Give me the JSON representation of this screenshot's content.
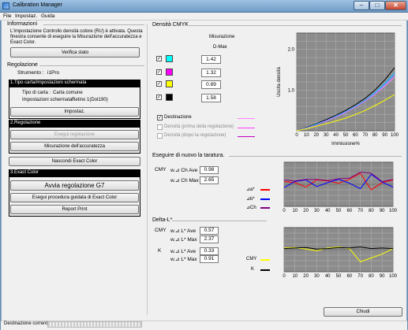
{
  "window": {
    "title": "Calibration Manager",
    "minimize_label": "–",
    "maximize_label": "□",
    "close_label": "✕"
  },
  "menu": {
    "file": "File",
    "settings": "Impostaz.",
    "help": "Guida"
  },
  "info": {
    "heading": "Informazioni",
    "text_line1": "L'impostazione Controllo densità colore (RU) è attivata. Questa",
    "text_line2": "finestra consente di eseguire la Misurazione dell'accuratezza e",
    "text_line3": "Exact Color.",
    "check_button": "Verifica stato"
  },
  "regulation": {
    "heading": "Regolazione",
    "instrument_label": "Strumento :",
    "instrument_value": "i1Pro",
    "section1_title": "1.Tipo carta/Impostazioni schermata",
    "paper_label": "Tipo di carta :",
    "paper_value": "Carta comune",
    "screen_label": "Impostazioni schermata :",
    "screen_value": "Retino 1(Dot190)",
    "settings_button": "Impostaz.",
    "section2_title": "2.Regolazione",
    "run_regulation_button": "Esegui regolazione",
    "accuracy_button": "Misurazione dell'accuratezza",
    "hide_exact_button": "Nascondi Exact Color",
    "section3_title": "3.Exact Color",
    "g7_button": "Avvia regolazione G7",
    "guided_button": "Esegui procedura guidata di Exact Color",
    "report_button": "Report Print"
  },
  "cmyk": {
    "heading": "Densità CMYK",
    "col_header1": "Misurazione",
    "col_header2": "D-Max",
    "rows": [
      {
        "name": "cyan",
        "color": "#00ffff",
        "value": "1.42",
        "check": "✓"
      },
      {
        "name": "magenta",
        "color": "#ff00ff",
        "value": "1.32",
        "check": "✓"
      },
      {
        "name": "yellow",
        "color": "#ffff00",
        "value": "0.89",
        "check": "✓"
      },
      {
        "name": "black",
        "color": "#000000",
        "value": "1.58",
        "check": "✓"
      }
    ],
    "legend": [
      {
        "label": "Destinazione",
        "check": "✓",
        "color": "#ff80ff"
      },
      {
        "label": "Densità (prima della regolazione)",
        "check": "",
        "color": "#ff40ff"
      },
      {
        "label": "Densità (dopo la regolazione)",
        "check": "",
        "color": "#c000c0"
      }
    ],
    "ylabel": "Uscita densità",
    "xlabel": "Immissione%"
  },
  "recal": {
    "heading": "Eseguire di nuovo la taratura.",
    "cmy_label": "CMY",
    "ave_label": "w.⊿ Ch Ave",
    "ave_value": "0.98",
    "max_label": "w.⊿ Ch Max",
    "max_value": "2.65",
    "legend": [
      {
        "label": "⊿a*",
        "color": "#ff0000"
      },
      {
        "label": "⊿b*",
        "color": "#0000ff"
      },
      {
        "label": "⊿Ch",
        "color": "#7f007f"
      }
    ]
  },
  "delta_l": {
    "heading": "Delta-L*",
    "cmy_label": "CMY",
    "k_label": "K",
    "cmy_ave_label": "w.⊿ L* Ave",
    "cmy_ave_value": "0.57",
    "cmy_max_label": "w.⊿ L* Max",
    "cmy_max_value": "2.37",
    "k_ave_label": "w.⊿ L* Ave",
    "k_ave_value": "0.33",
    "k_max_label": "w.⊿ L* Max",
    "k_max_value": "0.91",
    "legend": [
      {
        "label": "CMY",
        "color": "#ffff00"
      },
      {
        "label": "K",
        "color": "#000000"
      }
    ]
  },
  "footer": {
    "close_button": "Chiudi",
    "status_label": "Destinazione corrente"
  },
  "chart_data": [
    {
      "type": "line",
      "xlabel": "Immissione%",
      "ylabel": "Uscita densità",
      "x": [
        0,
        10,
        20,
        30,
        40,
        50,
        60,
        70,
        80,
        90,
        100
      ],
      "xlim": [
        0,
        100
      ],
      "ylim": [
        0,
        2.4
      ],
      "yticks": [
        "1.0",
        "2.0"
      ],
      "series": [
        {
          "color": "#000000",
          "values": [
            0,
            0.08,
            0.17,
            0.27,
            0.38,
            0.5,
            0.64,
            0.8,
            1.0,
            1.25,
            1.55
          ]
        },
        {
          "color": "#ff80ff",
          "values": [
            0,
            0.07,
            0.15,
            0.24,
            0.34,
            0.45,
            0.58,
            0.73,
            0.9,
            1.1,
            1.32
          ]
        },
        {
          "color": "#00c8ff",
          "values": [
            0,
            0.07,
            0.16,
            0.25,
            0.36,
            0.47,
            0.6,
            0.75,
            0.94,
            1.16,
            1.42
          ]
        },
        {
          "color": "#7f7fff",
          "values": [
            0,
            0.07,
            0.15,
            0.25,
            0.35,
            0.46,
            0.59,
            0.74,
            0.92,
            1.13,
            1.38
          ]
        },
        {
          "color": "#ffff00",
          "values": [
            0,
            0.05,
            0.11,
            0.17,
            0.24,
            0.31,
            0.4,
            0.5,
            0.62,
            0.75,
            0.89
          ]
        }
      ]
    },
    {
      "type": "line",
      "x": [
        0,
        10,
        20,
        30,
        40,
        50,
        60,
        70,
        80,
        90,
        100
      ],
      "xlim": [
        0,
        100
      ],
      "ylim": [
        -4,
        4
      ],
      "series": [
        {
          "name": "⊿a*",
          "color": "#ff0000",
          "values": [
            0.5,
            0.3,
            -0.5,
            0.8,
            0.6,
            0.2,
            0.9,
            2.0,
            -1.0,
            0.3,
            0.8
          ]
        },
        {
          "name": "⊿b*",
          "color": "#0000ff",
          "values": [
            -0.6,
            0.5,
            0.8,
            -0.4,
            0.3,
            0.9,
            0.2,
            -0.8,
            1.8,
            0.4,
            -0.5
          ]
        },
        {
          "name": "⊿Ch",
          "color": "#7f007f",
          "values": [
            0.8,
            0.6,
            0.9,
            0.9,
            0.7,
            1.0,
            1.1,
            2.2,
            2.0,
            0.5,
            0.9
          ]
        }
      ]
    },
    {
      "type": "line",
      "x": [
        0,
        10,
        20,
        30,
        40,
        50,
        60,
        70,
        80,
        90,
        100
      ],
      "xlim": [
        0,
        100
      ],
      "ylim": [
        -4,
        4
      ],
      "series": [
        {
          "name": "CMY",
          "color": "#ffff00",
          "values": [
            0.3,
            0.4,
            0.1,
            -0.2,
            0.3,
            0.5,
            0.2,
            -2.2,
            -1.5,
            -0.8,
            0.2
          ]
        },
        {
          "name": "K",
          "color": "#000000",
          "values": [
            0.2,
            0.3,
            0.4,
            0.1,
            0.2,
            0.4,
            0.3,
            0.5,
            0.2,
            0.3,
            0.2
          ]
        }
      ]
    }
  ]
}
